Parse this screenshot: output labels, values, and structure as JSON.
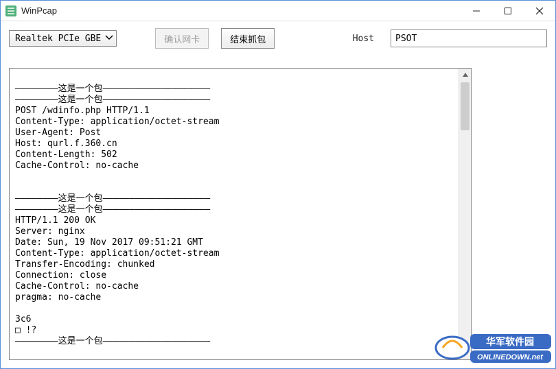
{
  "window": {
    "title": "WinPcap"
  },
  "toolbar": {
    "nic_selected": "Realtek PCIe GBE",
    "confirm_nic_label": "确认网卡",
    "stop_capture_label": "结束抓包",
    "host_label": "Host",
    "host_value": "PSOT"
  },
  "packet_output": "\n————————这是一个包————————————————————\n————————这是一个包————————————————————\nPOST /wdinfo.php HTTP/1.1\nContent-Type: application/octet-stream\nUser-Agent: Post\nHost: qurl.f.360.cn\nContent-Length: 502\nCache-Control: no-cache\n\n\n————————这是一个包————————————————————\n————————这是一个包————————————————————\nHTTP/1.1 200 OK\nServer: nginx\nDate: Sun, 19 Nov 2017 09:51:21 GMT\nContent-Type: application/octet-stream\nTransfer-Encoding: chunked\nConnection: close\nCache-Control: no-cache\npragma: no-cache\n\n3c6\n□ !?\n————————这是一个包————————————————————",
  "watermark": {
    "line1": "华军软件园",
    "line2": "ONLINEDOWN.net"
  }
}
